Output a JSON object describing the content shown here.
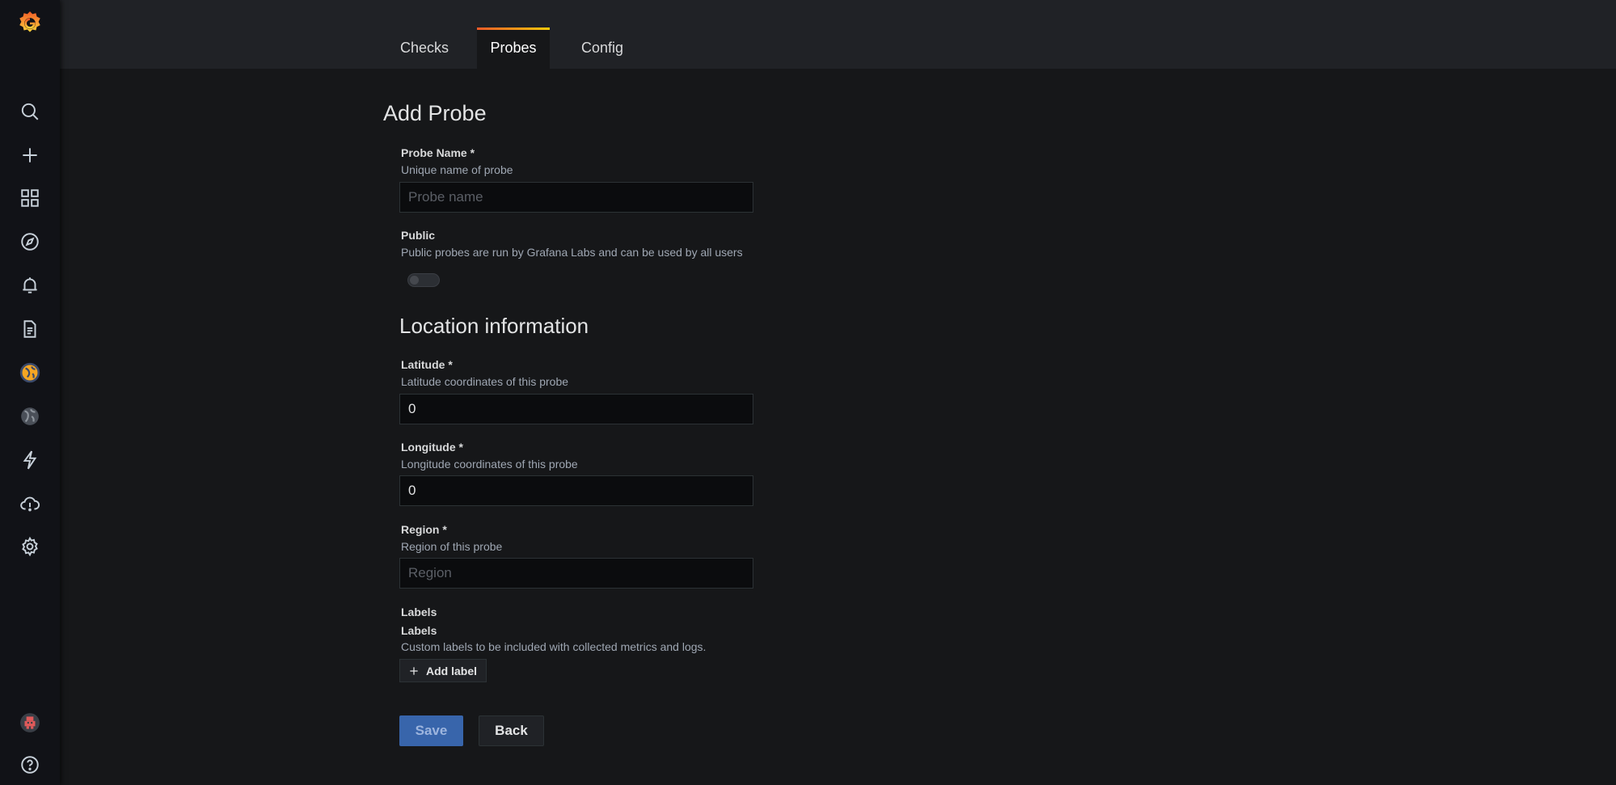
{
  "tabs": [
    "Checks",
    "Probes",
    "Config"
  ],
  "active_tab": "Probes",
  "page_title": "Add Probe",
  "fields": {
    "probe_name": {
      "label": "Probe Name *",
      "description": "Unique name of probe",
      "placeholder": "Probe name",
      "value": ""
    },
    "public": {
      "label": "Public",
      "description": "Public probes are run by Grafana Labs and can be used by all users",
      "enabled": false
    }
  },
  "location": {
    "heading": "Location information",
    "latitude": {
      "label": "Latitude *",
      "description": "Latitude coordinates of this probe",
      "value": "0"
    },
    "longitude": {
      "label": "Longitude *",
      "description": "Longitude coordinates of this probe",
      "value": "0"
    },
    "region": {
      "label": "Region *",
      "description": "Region of this probe",
      "placeholder": "Region",
      "value": ""
    }
  },
  "labels": {
    "section_label": "Labels",
    "label": "Labels",
    "description": "Custom labels to be included with collected metrics and logs.",
    "add_button": "Add label"
  },
  "actions": {
    "save": "Save",
    "back": "Back"
  },
  "sidebar_icons": [
    "grafana-logo-icon",
    "search-icon",
    "plus-icon",
    "dashboards-icon",
    "explore-icon",
    "alerting-icon",
    "document-icon",
    "synthetic-monitoring-icon",
    "worldmap-icon",
    "bolt-icon",
    "cloud-alert-icon",
    "gear-icon",
    "user-avatar-icon",
    "help-icon"
  ],
  "colors": {
    "accent": "#f05a28",
    "primary": "#3865ab",
    "background": "#161719",
    "sidebar": "#111217"
  }
}
